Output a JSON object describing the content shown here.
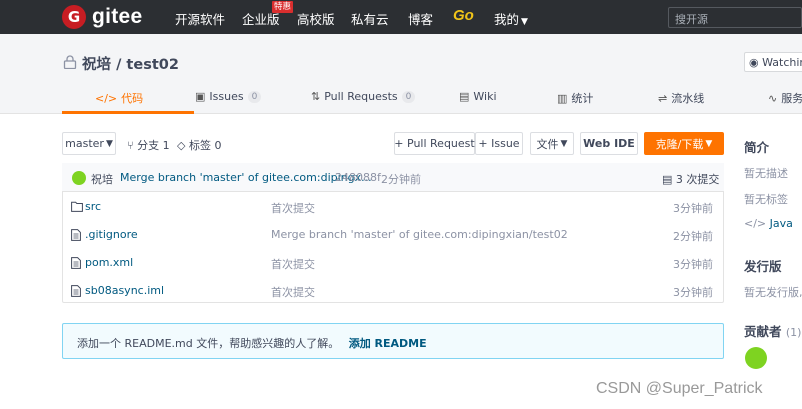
{
  "nav": {
    "logo_text": "gitee",
    "items": [
      {
        "label": "开源软件"
      },
      {
        "label": "企业版"
      },
      {
        "label": "高校版"
      },
      {
        "label": "私有云"
      },
      {
        "label": "博客"
      }
    ],
    "badge": "特惠",
    "go_label": "Go",
    "mine_label": "我的",
    "search_placeholder": "搜开源"
  },
  "repo": {
    "owner": "祝培",
    "separator": "/",
    "name": "test02",
    "watch_label": "Watching"
  },
  "tabs": [
    {
      "label": "代码",
      "count": "",
      "icon": "code-icon",
      "active": true
    },
    {
      "label": "Issues",
      "count": "0",
      "icon": "issues-icon"
    },
    {
      "label": "Pull Requests",
      "count": "0",
      "icon": "pull-request-icon"
    },
    {
      "label": "Wiki",
      "count": "",
      "icon": "wiki-icon"
    },
    {
      "label": "统计",
      "count": "",
      "icon": "chart-icon"
    },
    {
      "label": "流水线",
      "count": "",
      "icon": "pipeline-icon"
    },
    {
      "label": "服务",
      "count": "",
      "icon": "service-icon"
    }
  ],
  "toolbar": {
    "branch": "master",
    "branches_label": "分支 1",
    "tags_label": "标签 0",
    "pull_request_label": "+ Pull Request",
    "issue_label": "+ Issue",
    "file_label": "文件",
    "webide_label": "Web IDE",
    "clone_label": "克隆/下载"
  },
  "commit": {
    "author": "祝培",
    "message": "Merge branch 'master' of gitee.com:dipingx...",
    "hash": "248088f",
    "time": "2分钟前",
    "count_label": "3 次提交"
  },
  "files": [
    {
      "name": "src",
      "type": "folder",
      "message": "首次提交",
      "time": "3分钟前"
    },
    {
      "name": ".gitignore",
      "type": "file",
      "message": "Merge branch 'master' of gitee.com:dipingxian/test02",
      "time": "2分钟前"
    },
    {
      "name": "pom.xml",
      "type": "file",
      "message": "首次提交",
      "time": "3分钟前"
    },
    {
      "name": "sb08async.iml",
      "type": "file",
      "message": "首次提交",
      "time": "3分钟前"
    }
  ],
  "readme": {
    "text": "添加一个 README.md 文件，帮助感兴趣的人了解。",
    "link": "添加 README"
  },
  "sidebar": {
    "intro_title": "简介",
    "no_description": "暂无描述",
    "no_tags": "暂无标签",
    "language": "Java",
    "releases_title": "发行版",
    "no_releases": "暂无发行版,",
    "contributors_title": "贡献者",
    "contributors_count": "(1)"
  },
  "watermark": "CSDN @Super_Patrick",
  "colors": {
    "accent": "#fe7300",
    "nav_bg": "#2c2f33",
    "brand_red": "#c71d23",
    "link": "#005980"
  }
}
